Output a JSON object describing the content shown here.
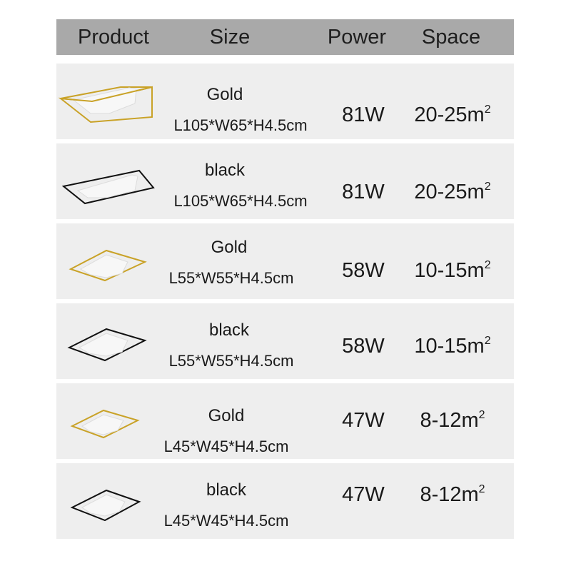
{
  "table": {
    "headers": {
      "product": "Product",
      "size": "Size",
      "power": "Power",
      "space": "Space"
    },
    "rows": [
      {
        "color": "Gold",
        "size": "L105*W65*H4.5cm",
        "power": "81W",
        "space": "20-25m",
        "space_unit_sup": "2",
        "frame_color": "#c9a227",
        "shape": "rectangle"
      },
      {
        "color": "black",
        "size": "L105*W65*H4.5cm",
        "power": "81W",
        "space": "20-25m",
        "space_unit_sup": "2",
        "frame_color": "#111111",
        "shape": "rectangle"
      },
      {
        "color": "Gold",
        "size": "L55*W55*H4.5cm",
        "power": "58W",
        "space": "10-15m",
        "space_unit_sup": "2",
        "frame_color": "#c9a227",
        "shape": "square"
      },
      {
        "color": "black",
        "size": "L55*W55*H4.5cm",
        "power": "58W",
        "space": "10-15m",
        "space_unit_sup": "2",
        "frame_color": "#111111",
        "shape": "square"
      },
      {
        "color": "Gold",
        "size": "L45*W45*H4.5cm",
        "power": "47W",
        "space": "8-12m",
        "space_unit_sup": "2",
        "frame_color": "#c9a227",
        "shape": "square"
      },
      {
        "color": "black",
        "size": "L45*W45*H4.5cm",
        "power": "47W",
        "space": "8-12m",
        "space_unit_sup": "2",
        "frame_color": "#111111",
        "shape": "square"
      }
    ]
  }
}
